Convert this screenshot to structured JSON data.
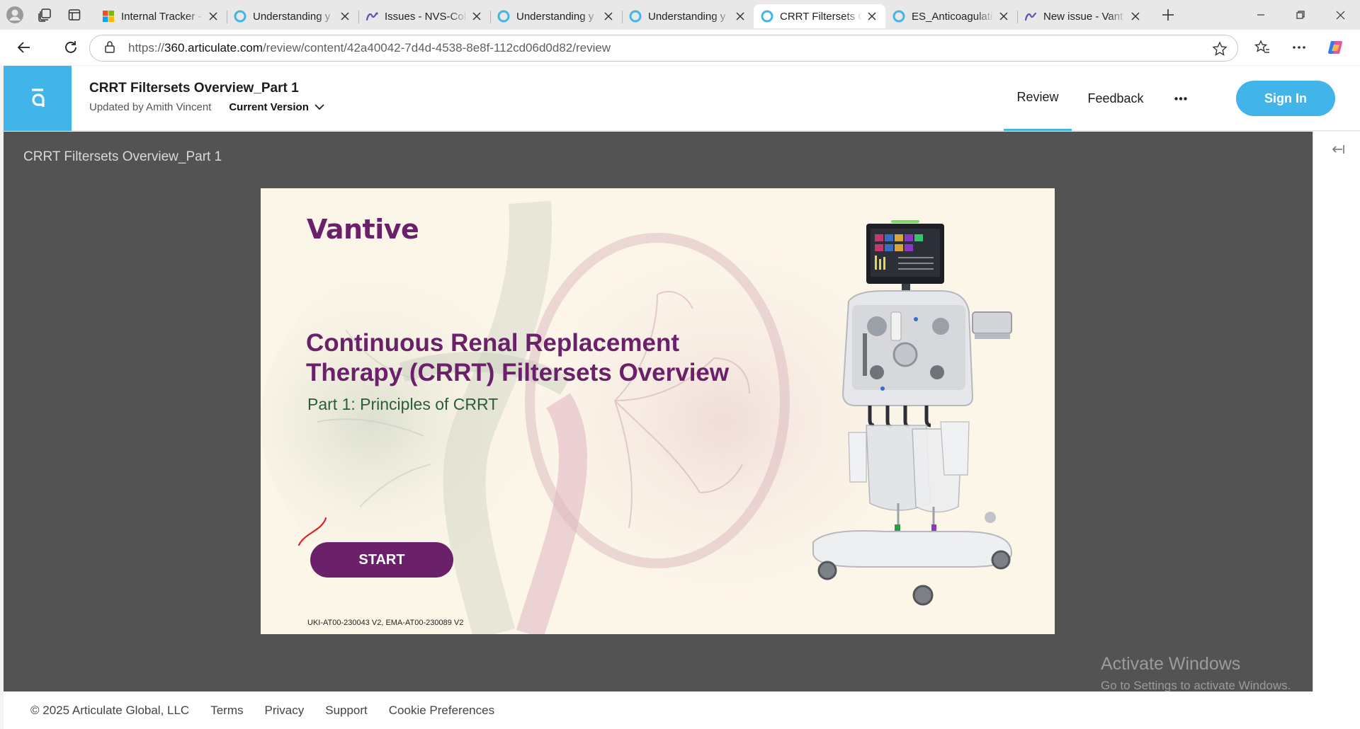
{
  "browser": {
    "tabs": [
      {
        "title": "Internal Tracker -",
        "icon": "microsoft-icon",
        "active": false
      },
      {
        "title": "Understanding y",
        "icon": "articulate-circle-icon",
        "active": false
      },
      {
        "title": "Issues - NVS-Col",
        "icon": "jira-icon",
        "active": false
      },
      {
        "title": "Understanding y",
        "icon": "articulate-circle-icon",
        "active": false
      },
      {
        "title": "Understanding y",
        "icon": "articulate-circle-icon",
        "active": false
      },
      {
        "title": "CRRT Filtersets C",
        "icon": "articulate-circle-icon",
        "active": true
      },
      {
        "title": "ES_Anticoagulati",
        "icon": "articulate-circle-icon",
        "active": false
      },
      {
        "title": "New issue - Vant",
        "icon": "jira-icon",
        "active": false
      }
    ],
    "url_prefix": "https://",
    "url_domain": "360.articulate.com",
    "url_path": "/review/content/42a40042-7d4d-4538-8e8f-112cd06d0d82/review"
  },
  "header": {
    "doc_title": "CRRT Filtersets Overview_Part 1",
    "updated_by": "Updated by Amith Vincent",
    "version_label": "Current Version",
    "nav_review": "Review",
    "nav_feedback": "Feedback",
    "more_label": "•••",
    "sign_in": "Sign In",
    "accent_color": "#41b5ea"
  },
  "stage": {
    "title": "CRRT Filtersets Overview_Part 1"
  },
  "slide": {
    "brand": "Vantive",
    "headline_line1": "Continuous Renal Replacement",
    "headline_line2": "Therapy (CRRT) Filtersets Overview",
    "subhead": "Part 1: Principles of CRRT",
    "start_label": "START",
    "footer_code": "UKI-AT00-230043 V2, EMA-AT00-230089 V2",
    "brand_color": "#6b2169"
  },
  "watermark": {
    "line1": "Activate Windows",
    "line2": "Go to Settings to activate Windows."
  },
  "footer": {
    "copyright": "© 2025 Articulate Global, LLC",
    "links": [
      "Terms",
      "Privacy",
      "Support",
      "Cookie Preferences"
    ]
  }
}
